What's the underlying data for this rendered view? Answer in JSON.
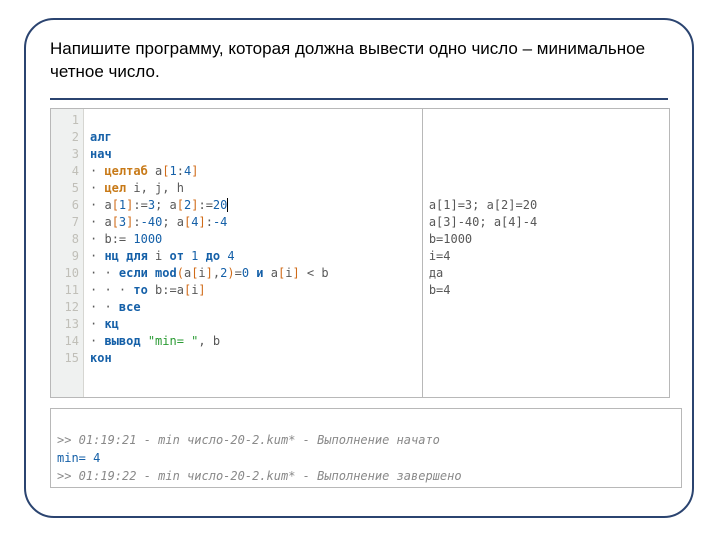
{
  "title_line1": "Напишите программу, которая должна вывести одно число – минимальное",
  "title_line2": "четное число.",
  "gutter": [
    "1",
    "2",
    "3",
    "4",
    "5",
    "6",
    "7",
    "8",
    "9",
    "10",
    "11",
    "12",
    "13",
    "14",
    "15"
  ],
  "code": {
    "l1_kw": "алг",
    "l2_kw": "нач",
    "l3_dot": "· ",
    "l3_kw": "целтаб ",
    "l3_id": "a",
    "l3_br1": "[",
    "l3_n1": "1",
    "l3_sep": ":",
    "l3_n2": "4",
    "l3_br2": "]",
    "l4_dot": "· ",
    "l4_kw": "цел ",
    "l4_vars": "i, j, h",
    "l5_dot": "· ",
    "l5_a": "a",
    "l5_b1": "[",
    "l5_n1": "1",
    "l5_b2": "]",
    "l5_eq": ":=",
    "l5_v1": "3",
    "l5_sep": "; ",
    "l5_a2": "a",
    "l5_b3": "[",
    "l5_n2": "2",
    "l5_b4": "]",
    "l5_eq2": ":=",
    "l5_v2": "20",
    "l6_dot": "· ",
    "l6_a": "a",
    "l6_b1": "[",
    "l6_n1": "3",
    "l6_b2": "]",
    "l6_eq": ":",
    "l6_v1": "-40",
    "l6_sep": "; ",
    "l6_a2": "a",
    "l6_b3": "[",
    "l6_n2": "4",
    "l6_b4": "]",
    "l6_eq2": ":",
    "l6_v2": "-4",
    "l7_dot": "· ",
    "l7_id": "b",
    "l7_eq": ":= ",
    "l7_v": "1000",
    "l8_dot": "· ",
    "l8_kw1": "нц для ",
    "l8_i": "i",
    "l8_kw2": " от ",
    "l8_n1": "1",
    "l8_kw3": " до ",
    "l8_n2": "4",
    "l9_dot": "· · ",
    "l9_kw": "если ",
    "l9_fn": "mod",
    "l9_p1": "(",
    "l9_a": "a",
    "l9_b1": "[",
    "l9_i": "i",
    "l9_b2": "]",
    "l9_c": ",",
    "l9_n2": "2",
    "l9_p2": ")",
    "l9_eq": "=",
    "l9_n0": "0",
    "l9_kw2": " и ",
    "l9_a2": "a",
    "l9_b3": "[",
    "l9_i2": "i",
    "l9_b4": "]",
    "l9_lt": " < b",
    "l10_dot": "· · · ",
    "l10_kw": "то ",
    "l10_expr": "b:=a",
    "l10_b1": "[",
    "l10_i": "i",
    "l10_b2": "]",
    "l11_dot": "· · ",
    "l11_kw": "все",
    "l12_dot": "· ",
    "l12_kw": "кц",
    "l13_dot": "· ",
    "l13_kw": "вывод ",
    "l13_str": "\"min= \"",
    "l13_rest": ", b",
    "l14_kw": "кон"
  },
  "vars": {
    "blank": " ",
    "r5": "a[1]=3; a[2]=20",
    "r6": "a[3]-40; a[4]-4",
    "r7": "b=1000",
    "r8": "i=4",
    "r9": "да",
    "r10": "b=4"
  },
  "console": {
    "l1_pre": ">> 01:19:21 - min число-20-2.kum* - Выполнение начато",
    "l2_pre": "min= ",
    "l2_val": "4",
    "l3_pre": ">> 01:19:22 - min число-20-2.kum* - Выполнение завершено"
  }
}
